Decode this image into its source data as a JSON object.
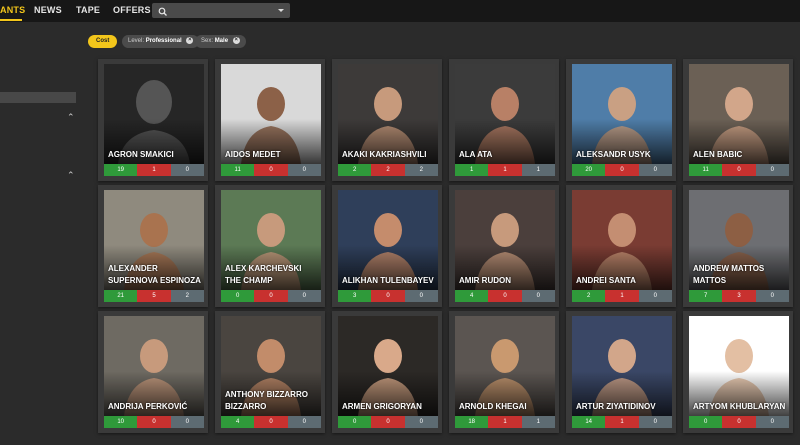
{
  "nav": {
    "items": [
      {
        "label": "ANTS",
        "active": true
      },
      {
        "label": "NEWS",
        "active": false
      },
      {
        "label": "TAPE",
        "active": false
      },
      {
        "label": "OFFERS",
        "active": false
      }
    ],
    "search": {
      "placeholder": "",
      "icon": "search-icon"
    }
  },
  "filters": {
    "cost_label": "Cost",
    "chips": [
      {
        "key": "Level:",
        "value": "Professional"
      },
      {
        "key": "Sex:",
        "value": "Male"
      }
    ]
  },
  "colors": {
    "accent": "#f3c61b",
    "win": "#2f9a3a",
    "loss": "#c8312f",
    "draw": "#5d6b72"
  },
  "fighters": [
    {
      "name": "AGRON SMAKICI",
      "wins": "19",
      "losses": "1",
      "draws": "0",
      "placeholder": true
    },
    {
      "name": "AIDOS MEDET",
      "wins": "11",
      "losses": "0",
      "draws": "0"
    },
    {
      "name": "AKAKI KAKRIASHVILI",
      "wins": "2",
      "losses": "2",
      "draws": "2"
    },
    {
      "name": "ALA ATA",
      "wins": "1",
      "losses": "1",
      "draws": "1"
    },
    {
      "name": "ALEKSANDR USYK",
      "wins": "20",
      "losses": "0",
      "draws": "0"
    },
    {
      "name": "ALEN BABIC",
      "wins": "11",
      "losses": "0",
      "draws": "0"
    },
    {
      "name": "ALEXANDER SUPERNOVA ESPINOZA",
      "wins": "21",
      "losses": "5",
      "draws": "2"
    },
    {
      "name": "ALEX KARCHEVSKI THE CHAMP",
      "wins": "0",
      "losses": "0",
      "draws": "0"
    },
    {
      "name": "ALIKHAN TULENBAYEV",
      "wins": "3",
      "losses": "0",
      "draws": "0"
    },
    {
      "name": "AMIR RUDON",
      "wins": "4",
      "losses": "0",
      "draws": "0"
    },
    {
      "name": "ANDREI SANTA",
      "wins": "2",
      "losses": "1",
      "draws": "0"
    },
    {
      "name": "ANDREW MATTOS MATTOS",
      "wins": "7",
      "losses": "3",
      "draws": "0"
    },
    {
      "name": "ANDRIJA PERKOVIĆ",
      "wins": "10",
      "losses": "0",
      "draws": "0"
    },
    {
      "name": "ANTHONY BIZZARRO BIZZARRO",
      "wins": "4",
      "losses": "0",
      "draws": "0"
    },
    {
      "name": "ARMEN GRIGORYAN",
      "wins": "0",
      "losses": "0",
      "draws": "0"
    },
    {
      "name": "ARNOLD KHEGAI",
      "wins": "18",
      "losses": "1",
      "draws": "1"
    },
    {
      "name": "ARTUR ZIYATIDINOV",
      "wins": "14",
      "losses": "1",
      "draws": "0"
    },
    {
      "name": "ARTYOM KHUBLARYAN",
      "wins": "0",
      "losses": "0",
      "draws": "0"
    }
  ]
}
